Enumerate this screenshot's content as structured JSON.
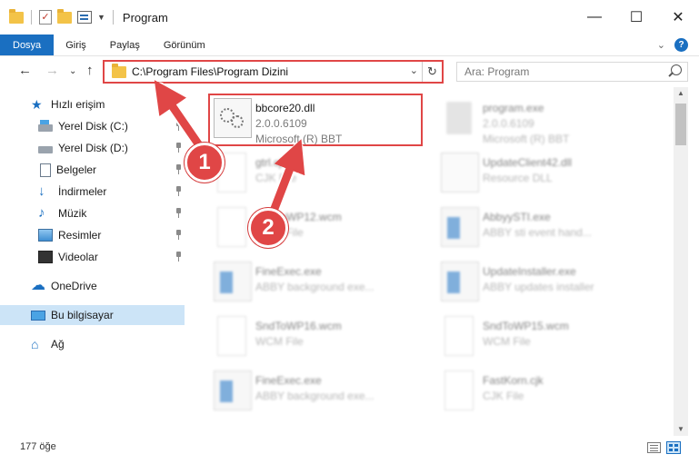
{
  "window": {
    "title": "Program"
  },
  "ribbon": {
    "tabs": [
      "Dosya",
      "Giriş",
      "Paylaş",
      "Görünüm"
    ]
  },
  "address": {
    "path": "C:\\Program Files\\Program Dizini"
  },
  "search": {
    "placeholder": "Ara: Program"
  },
  "sidebar": {
    "items": [
      {
        "label": "Hızlı erişim"
      },
      {
        "label": "Yerel Disk (C:)"
      },
      {
        "label": "Yerel Disk (D:)"
      },
      {
        "label": "Belgeler"
      },
      {
        "label": "İndirmeler"
      },
      {
        "label": "Müzik"
      },
      {
        "label": "Resimler"
      },
      {
        "label": "Videolar"
      },
      {
        "label": "OneDrive"
      },
      {
        "label": "Bu bilgisayar"
      },
      {
        "label": "Ağ"
      }
    ]
  },
  "files": [
    {
      "name": "bbcore20.dll",
      "line2": "2.0.0.6109",
      "line3": "Microsoft (R) BBT"
    },
    {
      "name": "program.exe",
      "line2": "2.0.0.6109",
      "line3": "Microsoft (R) BBT"
    },
    {
      "name": "gtrl.cjk",
      "line2": "CJK File",
      "line3": ""
    },
    {
      "name": "UpdateClient42.dll",
      "line2": "Resource DLL",
      "line3": ""
    },
    {
      "name": "SndToWP12.wcm",
      "line2": "WCM File",
      "line3": ""
    },
    {
      "name": "AbbyySTI.exe",
      "line2": "ABBY sti event hand...",
      "line3": ""
    },
    {
      "name": "FineExec.exe",
      "line2": "ABBY background exe...",
      "line3": ""
    },
    {
      "name": "UpdateInstaller.exe",
      "line2": "ABBY updates installer",
      "line3": ""
    },
    {
      "name": "SndToWP16.wcm",
      "line2": "WCM File",
      "line3": ""
    },
    {
      "name": "SndToWP15.wcm",
      "line2": "WCM File",
      "line3": ""
    },
    {
      "name": "FineExec.exe",
      "line2": "ABBY background exe...",
      "line3": ""
    },
    {
      "name": "FastKorn.cjk",
      "line2": "CJK File",
      "line3": ""
    }
  ],
  "status": {
    "count": "177 öğe"
  },
  "annotations": {
    "badge1": "1",
    "badge2": "2",
    "color": "#e04646"
  }
}
